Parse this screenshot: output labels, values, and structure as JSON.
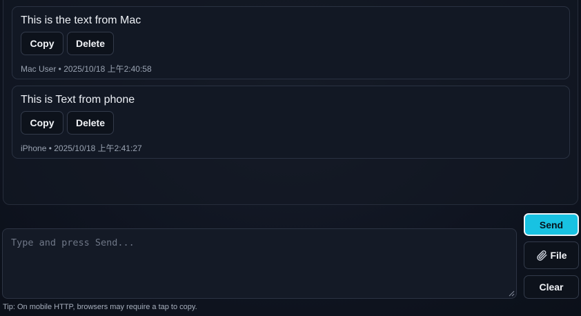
{
  "messages": [
    {
      "text": "This is the text from Mac",
      "copy_label": "Copy",
      "delete_label": "Delete",
      "meta": "Mac User • 2025/10/18 上午2:40:58"
    },
    {
      "text": "This is Text from phone",
      "copy_label": "Copy",
      "delete_label": "Delete",
      "meta": "iPhone • 2025/10/18 上午2:41:27"
    }
  ],
  "composer": {
    "placeholder": "Type and press Send..."
  },
  "actions": {
    "send_label": "Send",
    "file_label": "File",
    "file_icon": "paperclip-icon",
    "clear_label": "Clear"
  },
  "tip": "Tip: On mobile HTTP, browsers may require a tap to copy.",
  "colors": {
    "accent": "#18c2e2",
    "background": "#0f1420",
    "card": "#121824",
    "muted_text": "#9aa3b2"
  }
}
